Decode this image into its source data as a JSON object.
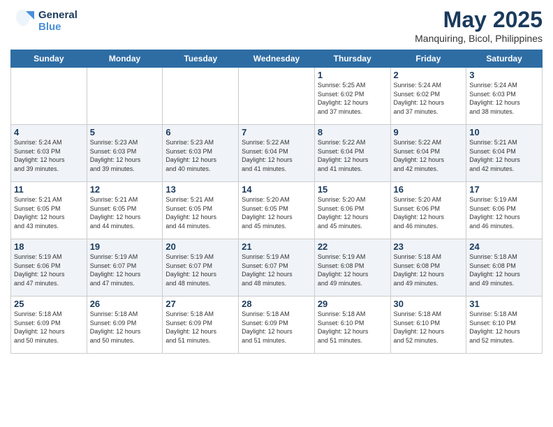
{
  "header": {
    "logo_line1": "General",
    "logo_line2": "Blue",
    "title": "May 2025",
    "subtitle": "Manquiring, Bicol, Philippines"
  },
  "days_of_week": [
    "Sunday",
    "Monday",
    "Tuesday",
    "Wednesday",
    "Thursday",
    "Friday",
    "Saturday"
  ],
  "weeks": [
    [
      {
        "day": "",
        "info": ""
      },
      {
        "day": "",
        "info": ""
      },
      {
        "day": "",
        "info": ""
      },
      {
        "day": "",
        "info": ""
      },
      {
        "day": "1",
        "info": "Sunrise: 5:25 AM\nSunset: 6:02 PM\nDaylight: 12 hours\nand 37 minutes."
      },
      {
        "day": "2",
        "info": "Sunrise: 5:24 AM\nSunset: 6:02 PM\nDaylight: 12 hours\nand 37 minutes."
      },
      {
        "day": "3",
        "info": "Sunrise: 5:24 AM\nSunset: 6:03 PM\nDaylight: 12 hours\nand 38 minutes."
      }
    ],
    [
      {
        "day": "4",
        "info": "Sunrise: 5:24 AM\nSunset: 6:03 PM\nDaylight: 12 hours\nand 39 minutes."
      },
      {
        "day": "5",
        "info": "Sunrise: 5:23 AM\nSunset: 6:03 PM\nDaylight: 12 hours\nand 39 minutes."
      },
      {
        "day": "6",
        "info": "Sunrise: 5:23 AM\nSunset: 6:03 PM\nDaylight: 12 hours\nand 40 minutes."
      },
      {
        "day": "7",
        "info": "Sunrise: 5:22 AM\nSunset: 6:04 PM\nDaylight: 12 hours\nand 41 minutes."
      },
      {
        "day": "8",
        "info": "Sunrise: 5:22 AM\nSunset: 6:04 PM\nDaylight: 12 hours\nand 41 minutes."
      },
      {
        "day": "9",
        "info": "Sunrise: 5:22 AM\nSunset: 6:04 PM\nDaylight: 12 hours\nand 42 minutes."
      },
      {
        "day": "10",
        "info": "Sunrise: 5:21 AM\nSunset: 6:04 PM\nDaylight: 12 hours\nand 42 minutes."
      }
    ],
    [
      {
        "day": "11",
        "info": "Sunrise: 5:21 AM\nSunset: 6:05 PM\nDaylight: 12 hours\nand 43 minutes."
      },
      {
        "day": "12",
        "info": "Sunrise: 5:21 AM\nSunset: 6:05 PM\nDaylight: 12 hours\nand 44 minutes."
      },
      {
        "day": "13",
        "info": "Sunrise: 5:21 AM\nSunset: 6:05 PM\nDaylight: 12 hours\nand 44 minutes."
      },
      {
        "day": "14",
        "info": "Sunrise: 5:20 AM\nSunset: 6:05 PM\nDaylight: 12 hours\nand 45 minutes."
      },
      {
        "day": "15",
        "info": "Sunrise: 5:20 AM\nSunset: 6:06 PM\nDaylight: 12 hours\nand 45 minutes."
      },
      {
        "day": "16",
        "info": "Sunrise: 5:20 AM\nSunset: 6:06 PM\nDaylight: 12 hours\nand 46 minutes."
      },
      {
        "day": "17",
        "info": "Sunrise: 5:19 AM\nSunset: 6:06 PM\nDaylight: 12 hours\nand 46 minutes."
      }
    ],
    [
      {
        "day": "18",
        "info": "Sunrise: 5:19 AM\nSunset: 6:06 PM\nDaylight: 12 hours\nand 47 minutes."
      },
      {
        "day": "19",
        "info": "Sunrise: 5:19 AM\nSunset: 6:07 PM\nDaylight: 12 hours\nand 47 minutes."
      },
      {
        "day": "20",
        "info": "Sunrise: 5:19 AM\nSunset: 6:07 PM\nDaylight: 12 hours\nand 48 minutes."
      },
      {
        "day": "21",
        "info": "Sunrise: 5:19 AM\nSunset: 6:07 PM\nDaylight: 12 hours\nand 48 minutes."
      },
      {
        "day": "22",
        "info": "Sunrise: 5:19 AM\nSunset: 6:08 PM\nDaylight: 12 hours\nand 49 minutes."
      },
      {
        "day": "23",
        "info": "Sunrise: 5:18 AM\nSunset: 6:08 PM\nDaylight: 12 hours\nand 49 minutes."
      },
      {
        "day": "24",
        "info": "Sunrise: 5:18 AM\nSunset: 6:08 PM\nDaylight: 12 hours\nand 49 minutes."
      }
    ],
    [
      {
        "day": "25",
        "info": "Sunrise: 5:18 AM\nSunset: 6:09 PM\nDaylight: 12 hours\nand 50 minutes."
      },
      {
        "day": "26",
        "info": "Sunrise: 5:18 AM\nSunset: 6:09 PM\nDaylight: 12 hours\nand 50 minutes."
      },
      {
        "day": "27",
        "info": "Sunrise: 5:18 AM\nSunset: 6:09 PM\nDaylight: 12 hours\nand 51 minutes."
      },
      {
        "day": "28",
        "info": "Sunrise: 5:18 AM\nSunset: 6:09 PM\nDaylight: 12 hours\nand 51 minutes."
      },
      {
        "day": "29",
        "info": "Sunrise: 5:18 AM\nSunset: 6:10 PM\nDaylight: 12 hours\nand 51 minutes."
      },
      {
        "day": "30",
        "info": "Sunrise: 5:18 AM\nSunset: 6:10 PM\nDaylight: 12 hours\nand 52 minutes."
      },
      {
        "day": "31",
        "info": "Sunrise: 5:18 AM\nSunset: 6:10 PM\nDaylight: 12 hours\nand 52 minutes."
      }
    ]
  ]
}
